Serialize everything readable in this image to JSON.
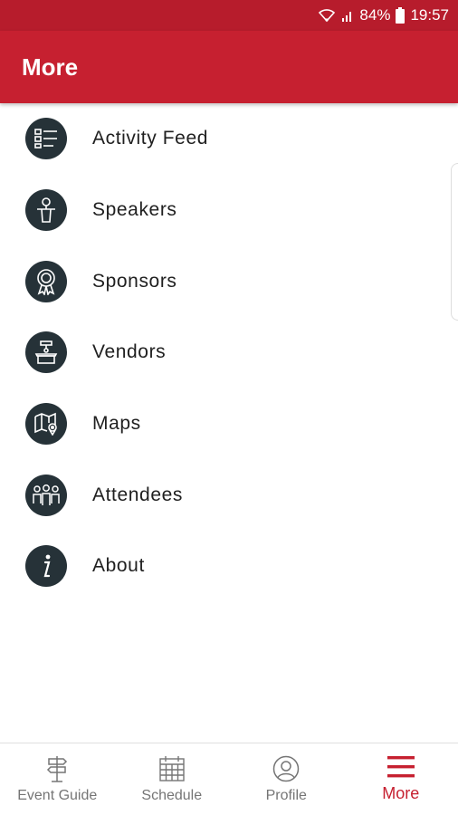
{
  "status_bar": {
    "battery": "84%",
    "time": "19:57",
    "icons": [
      "wifi-icon",
      "signal-icon",
      "battery-icon"
    ]
  },
  "app_bar": {
    "title": "More"
  },
  "menu": {
    "items": [
      {
        "label": "Activity Feed",
        "icon": "list-icon"
      },
      {
        "label": "Speakers",
        "icon": "speaker-podium-icon"
      },
      {
        "label": "Sponsors",
        "icon": "ribbon-award-icon"
      },
      {
        "label": "Vendors",
        "icon": "vendor-booth-icon"
      },
      {
        "label": "Maps",
        "icon": "map-icon"
      },
      {
        "label": "Attendees",
        "icon": "people-icon"
      },
      {
        "label": "About",
        "icon": "info-icon"
      }
    ]
  },
  "bottom_nav": {
    "items": [
      {
        "label": "Event Guide",
        "icon": "signpost-icon"
      },
      {
        "label": "Schedule",
        "icon": "calendar-icon"
      },
      {
        "label": "Profile",
        "icon": "profile-icon"
      },
      {
        "label": "More",
        "icon": "hamburger-menu-icon",
        "active": true
      }
    ]
  },
  "colors": {
    "brand_red": "#c62030",
    "status_bar": "#b71c2c",
    "icon_circle": "#263238",
    "inactive_nav": "#757575"
  }
}
